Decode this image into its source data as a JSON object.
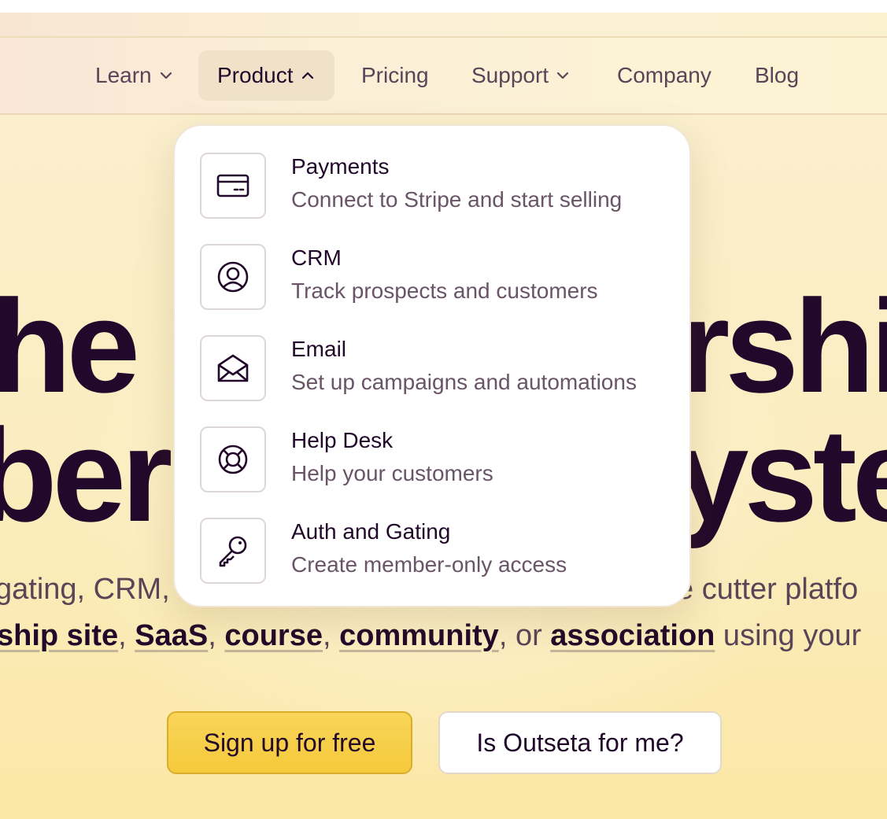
{
  "nav": {
    "items": [
      {
        "label": "Learn",
        "icon": "chevron-down-icon"
      },
      {
        "label": "Product",
        "icon": "chevron-up-icon",
        "active": true
      },
      {
        "label": "Pricing"
      },
      {
        "label": "Support",
        "icon": "chevron-down-icon"
      },
      {
        "label": "Company"
      },
      {
        "label": "Blog"
      }
    ]
  },
  "dropdown": {
    "items": [
      {
        "title": "Payments",
        "description": "Connect to Stripe and start selling",
        "icon": "credit-card-icon"
      },
      {
        "title": "CRM",
        "description": "Track prospects and customers",
        "icon": "user-circle-icon"
      },
      {
        "title": "Email",
        "description": "Set up campaigns and automations",
        "icon": "envelope-open-icon"
      },
      {
        "title": "Help Desk",
        "description": "Help your customers",
        "icon": "lifebuoy-icon"
      },
      {
        "title": "Auth and Gating",
        "description": "Create member-only access",
        "icon": "key-icon"
      }
    ]
  },
  "hero": {
    "line1_left": "he",
    "line1_right": "rshi",
    "line2_left": "ber",
    "line2_right": "yste",
    "sub1_left": "gating, CRM,",
    "sub1_right": "e cutter platfo",
    "sub2_link1": "ship site",
    "sub2_sep1": ", ",
    "sub2_link2": "SaaS",
    "sub2_sep2": ", ",
    "sub2_link3": "course",
    "sub2_sep3": ", ",
    "sub2_link4": "community",
    "sub2_sep4": ", or ",
    "sub2_link5": "association",
    "sub2_tail": " using your"
  },
  "buttons": {
    "signup": "Sign up for free",
    "is_for_me": "Is Outseta for me?"
  },
  "colors": {
    "text_dark": "#22082a",
    "text_muted": "#5a4457",
    "primary_button": "#f5c93a",
    "background": "#fbedc0"
  }
}
